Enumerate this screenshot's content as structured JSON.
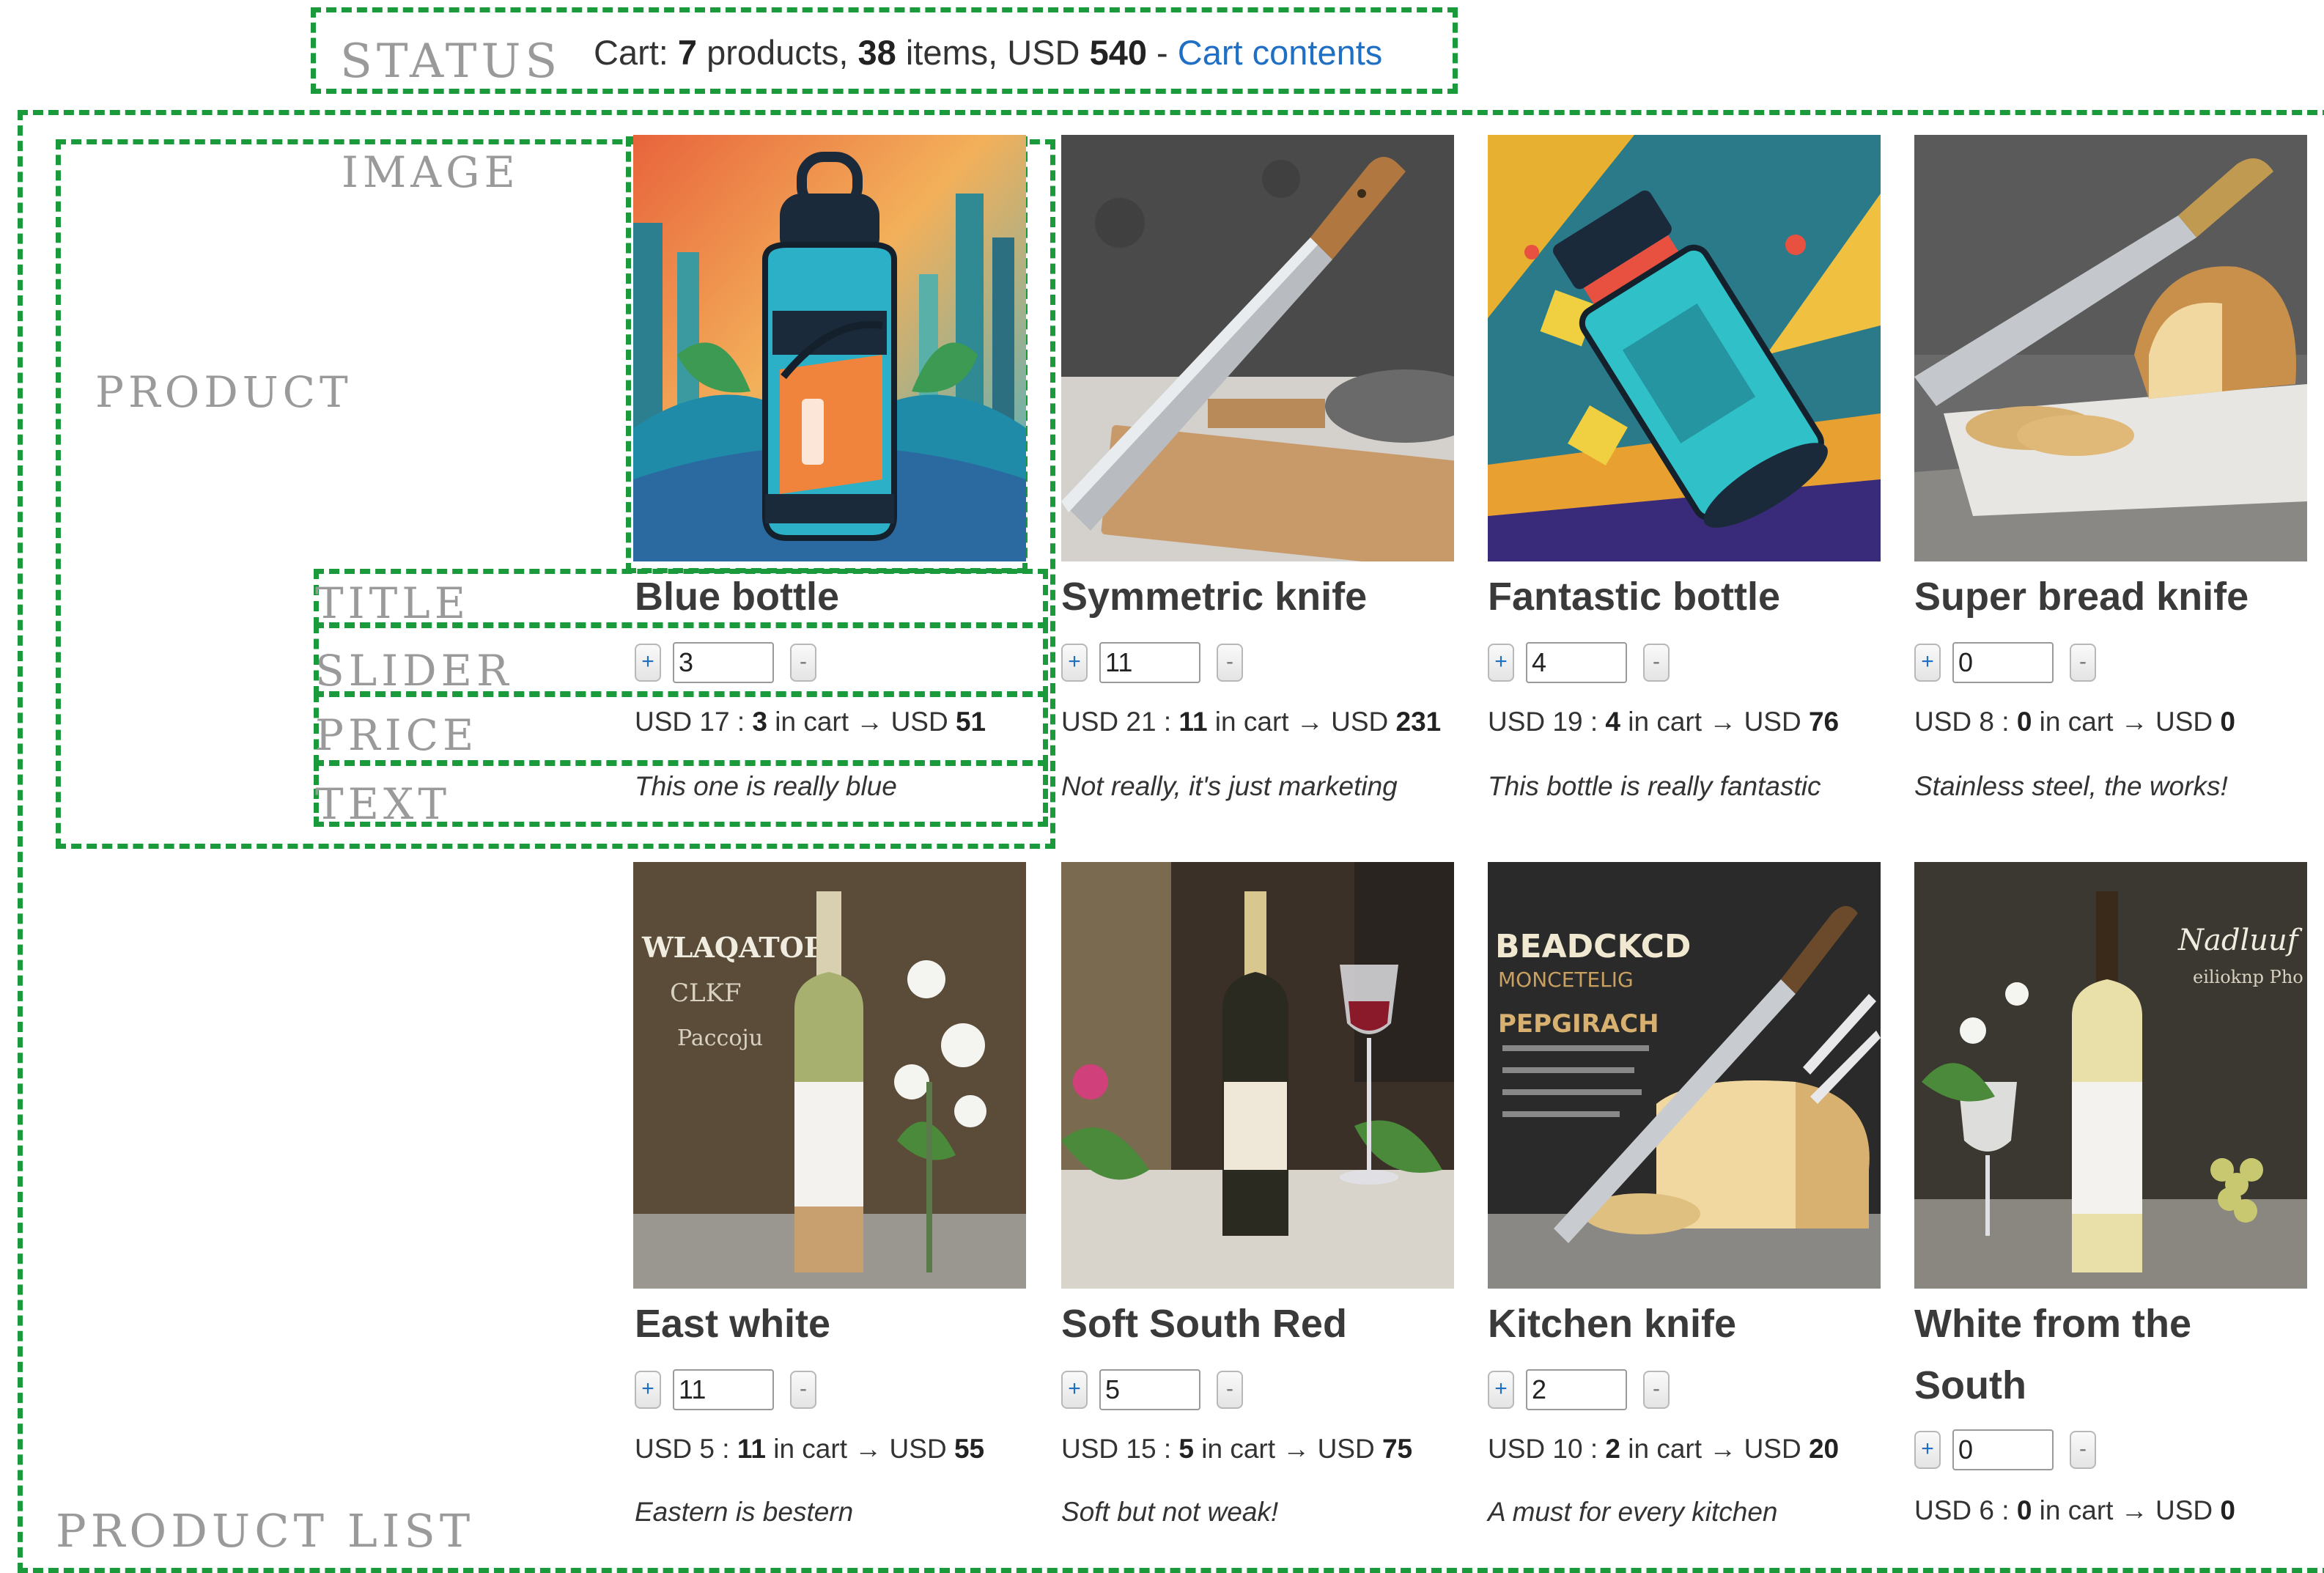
{
  "labels": {
    "status": "STATUS",
    "image": "IMAGE",
    "product": "PRODUCT",
    "title": "TITLE",
    "slider": "SLIDER",
    "price": "PRICE",
    "text": "TEXT",
    "product_list": "PRODUCT LIST"
  },
  "status": {
    "prefix": "Cart: ",
    "products": "7",
    "products_label": " products, ",
    "items": "38",
    "items_label": " items, USD ",
    "total": "540",
    "separator": " - ",
    "cart_link": "Cart contents"
  },
  "colors": {
    "dashed_outline": "#1a9a3a",
    "link": "#1f6fc5",
    "label_gray": "#9a9a9a"
  },
  "icons": {
    "plus": "+",
    "minus": "-",
    "arrow": "→"
  },
  "products": [
    {
      "title": "Blue bottle",
      "qty": "3",
      "price_prefix": "USD 17 : ",
      "in_cart_label": " in cart → USD ",
      "total": "51",
      "text": "This one is really blue"
    },
    {
      "title": "Symmetric knife",
      "qty": "11",
      "price_prefix": "USD 21 : ",
      "in_cart_label": " in cart → USD ",
      "total": "231",
      "text": "Not really, it's just marketing"
    },
    {
      "title": "Fantastic bottle",
      "qty": "4",
      "price_prefix": "USD 19 : ",
      "in_cart_label": " in cart → USD ",
      "total": "76",
      "text": "This bottle is really fantastic"
    },
    {
      "title": "Super bread knife",
      "qty": "0",
      "price_prefix": "USD 8 : ",
      "in_cart_label": " in cart → USD ",
      "total": "0",
      "text": "Stainless steel, the works!"
    },
    {
      "title": "East white",
      "qty": "11",
      "price_prefix": "USD 5 : ",
      "in_cart_label": " in cart → USD ",
      "total": "55",
      "text": "Eastern is bestern"
    },
    {
      "title": "Soft South Red",
      "qty": "5",
      "price_prefix": "USD 15 : ",
      "in_cart_label": " in cart → USD ",
      "total": "75",
      "text": "Soft but not weak!"
    },
    {
      "title": "Kitchen knife",
      "qty": "2",
      "price_prefix": "USD 10 : ",
      "in_cart_label": " in cart → USD ",
      "total": "20",
      "text": "A must for every kitchen"
    },
    {
      "title_line1": "White from the",
      "title_line2": "South",
      "qty": "0",
      "price_prefix": "USD 6 : ",
      "in_cart_label": " in cart → USD ",
      "total": "0",
      "text": ""
    }
  ],
  "image_texts": {
    "east_white_l1": "WLAQATOP",
    "east_white_l2": "CLKF",
    "east_white_l3": "Paccoju",
    "kitchen_l1": "BEADCKCD",
    "kitchen_l2": "MONCETELIG",
    "kitchen_l3": "PEPGIRACH",
    "white_south_l1": "Nadluuf",
    "white_south_l2": "eilioknp Pho"
  }
}
